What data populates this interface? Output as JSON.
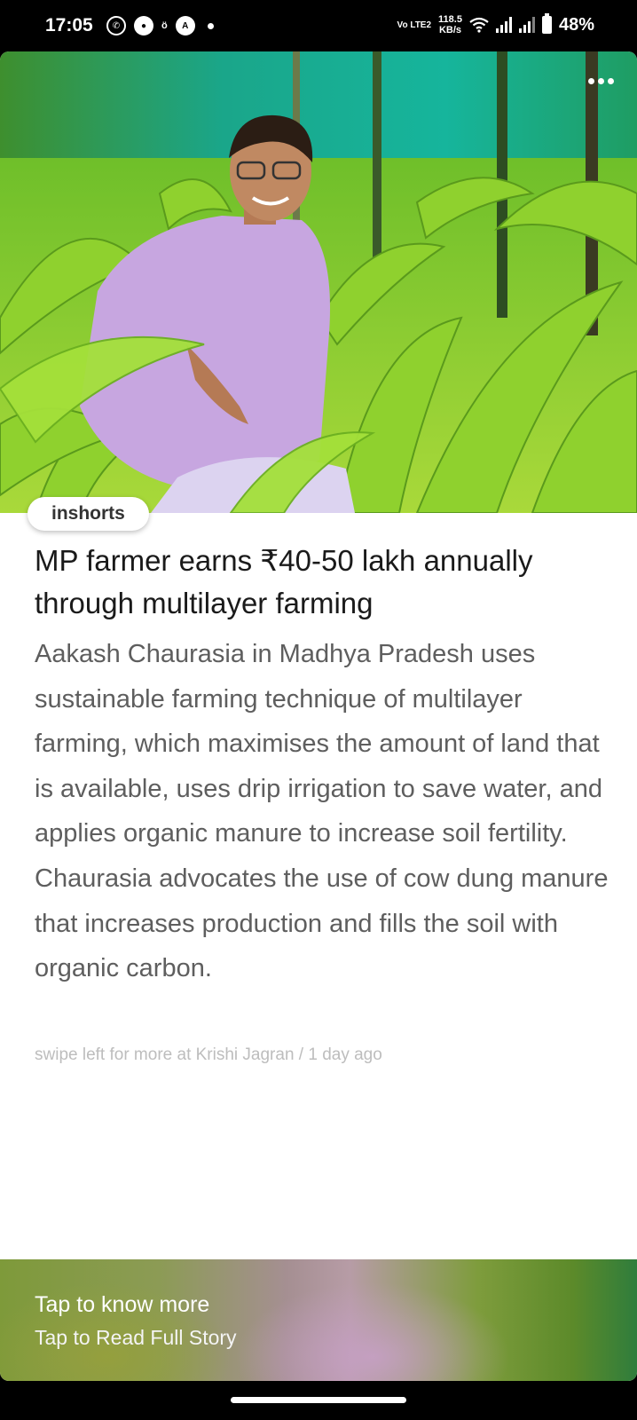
{
  "status_bar": {
    "time": "17:05",
    "volte": "Vo LTE2",
    "speed_value": "118.5",
    "speed_unit": "KB/s",
    "battery": "48%"
  },
  "card": {
    "brand": "inshorts",
    "headline": "MP farmer earns ₹40-50 lakh annually through multilayer farming",
    "summary": "Aakash Chaurasia in Madhya Pradesh uses sustainable farming technique of multilayer farming, which maximises the amount of land that is available, uses drip irrigation to save water, and applies organic manure to increase soil fertility. Chaurasia advocates the use of cow dung manure that increases production and fills the soil with organic carbon.",
    "source_line": "swipe left for more at Krishi Jagran / 1 day ago"
  },
  "footer": {
    "title": "Tap to know more",
    "subtitle": "Tap to Read Full Story"
  },
  "colors": {
    "accent_green": "#4a9a2c",
    "headline": "#1a1a1a",
    "summary": "#5e5e5e"
  }
}
